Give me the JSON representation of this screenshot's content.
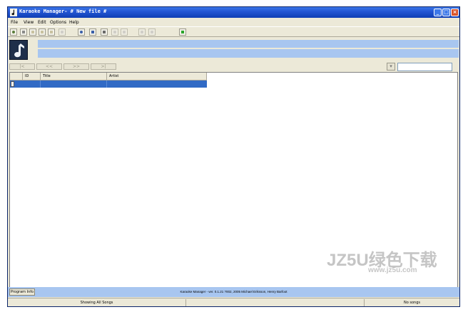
{
  "window": {
    "title": "Karaoke Manager- # New file #",
    "buttons": {
      "minimize": "_",
      "maximize": "□",
      "close": "×"
    }
  },
  "menu": [
    "File",
    "View",
    "Edit",
    "Options",
    "Help"
  ],
  "toolbar": {
    "icons": [
      "add-icon",
      "grid-icon",
      "folder-icon",
      "open-icon",
      "save-icon",
      "delete-icon",
      "search-icon",
      "print-icon",
      "export-icon",
      "cut-icon",
      "copy-icon",
      "paste-icon",
      "undo-icon",
      "exit-icon"
    ]
  },
  "nav": {
    "first": "|<",
    "prev": "<<",
    "next": ">>",
    "last": ">|",
    "search_placeholder": ""
  },
  "table": {
    "columns": [
      "ID",
      "Title",
      "Artist"
    ],
    "rows": [
      {
        "id": "",
        "title": "",
        "artist": ""
      }
    ]
  },
  "bottom": {
    "program_info": "Program Info",
    "version": "Karaoke Manager - ver. 0.1.21 ?002, 2005 Michael Eriksson, Henry Barfoot",
    "status": "Showing All Songs",
    "right_status": "No songs"
  },
  "watermark": {
    "line1": "JZ5U绿色下载",
    "line2": "www.jz5u.com"
  },
  "colors": {
    "titlebar": "#2356d4",
    "selection": "#316ac5",
    "info_panel": "#a8c6f0",
    "close_button": "#d9542c"
  }
}
